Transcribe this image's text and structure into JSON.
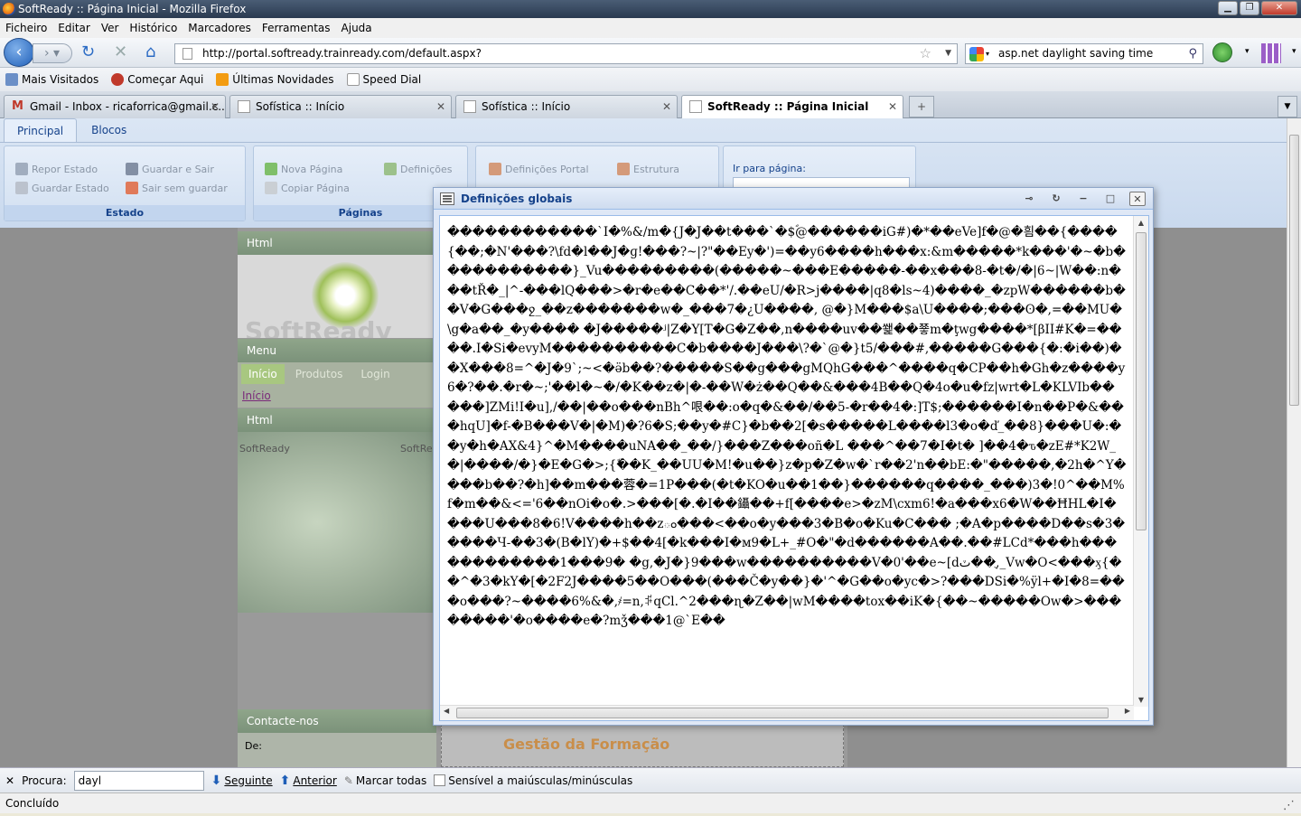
{
  "window": {
    "title": "SoftReady :: Página Inicial - Mozilla Firefox"
  },
  "menu": [
    "Ficheiro",
    "Editar",
    "Ver",
    "Histórico",
    "Marcadores",
    "Ferramentas",
    "Ajuda"
  ],
  "nav": {
    "url": "http://portal.softready.trainready.com/default.aspx?",
    "search_value": "asp.net daylight saving time"
  },
  "bookmarks": [
    "Mais Visitados",
    "Começar Aqui",
    "Últimas Novidades",
    "Speed Dial"
  ],
  "tabs": [
    {
      "label": "Gmail - Inbox - ricaforrica@gmail.c..."
    },
    {
      "label": "Sofística :: Início"
    },
    {
      "label": "Sofística :: Início"
    },
    {
      "label": "SoftReady :: Página Inicial"
    }
  ],
  "ribbon": {
    "tabs": [
      "Principal",
      "Blocos"
    ],
    "estado": {
      "repor": "Repor Estado",
      "guardar_sair": "Guardar e Sair",
      "guardar_estado": "Guardar Estado",
      "sair_sem": "Sair sem guardar",
      "label": "Estado"
    },
    "paginas": {
      "nova": "Nova Página",
      "definicoes": "Definições",
      "copiar": "Copiar Página",
      "label": "Páginas"
    },
    "portal": {
      "definicoes_portal": "Definições Portal",
      "estrutura": "Estrutura"
    },
    "ir_para": "Ir para página:"
  },
  "portal": {
    "html_header": "Html",
    "logo_text": "SoftReady",
    "menu_header": "Menu",
    "menu_links": [
      "Início",
      "Produtos",
      "Login"
    ],
    "inicio_link": "Início",
    "html_header2": "Html",
    "softready_small_1": "SoftReady",
    "softready_small_2": "SoftRe",
    "contact_header": "Contacte-nos",
    "de_label": "De:",
    "gestao_title": "Gestão da Formação"
  },
  "dialog": {
    "title": "Definições globais",
    "body_text": "������������`I�%&/m�{J�J��t���`�$ؐ@������iG#)�*��eVe]f�@�흼��{����{��;�N'���?\\fd�l��J�ɡ!���?~|?\"��Ey�')=��y6����h���x:&m�����*k���'�~�b�����������}_Vu���������(�����~���E�����-��x���8-�t�/�|6~|W��:n���tŘ�_|^-���lQ���>�r�e��C��*'/.��eU/�R>j����|q8�ls~4)����_�zpW������b��V�G���ջ_��z�������w�_���7�¿U����, @�}M���$a\\U����;���ʘ�,=��MU� \\g�a��_�y���� �J�����ʲ|Z�Y[T�G�Z��,n����uv��쐝��쭇m�ţwg����*[βII#K�=����.I�Si�evyM����������C�b����J���\\?�`@�}t5/���#,�����G���{�:�i��)��X���8=^�J�9`;~<�ӛb��?�����S��g���gMQhG���^����q�CP��h�Gh�z����y6�?��.�r�~;'��l�~�/�K��z�|�-��W�ż��Q��&���4B��Q�4o�u�fz|wrt�L�KLVIb�����]ZMi!I�u],/��|��o���nBh^哏��:o�q�&��/��5-�r��4�:]T$;������I�n��P�&���hqU]�f-�B���V�|�M)�?6�S;��y�#C}�b��2[�s�����L����l3�o�ď_��8}���U�:��y�h�AX&4}^�M����uNA��_��/}���Z���oñ�L ���^��7�I�t� ]��4�ԏ�zE#*K2W_�|����/�}�E�G�>;{�ّ�K_��UU�M!�u��}z�p�Z�w�`r��2'n��bE:�\"�����,�2h�^Y����b��?�h]��m���蓉�=1P���(�t�KO�u��1��}������q����_���)3�!0^��M%f�m��&<='6��nOi�o�.>���[�.�I��鑷��+f[����e>�zM\\cxm6!�a���x6�W��ĦHL�I����U���8�6!V����h��zం���<��o�y���3�B�o�Ku�C��� ;�A�p����D��s�3�����Ч-��3�(B�lY)�+$��4[�k���I�м9�L+_#O�\"�d������A��.��#LCd*���h������������1���9� �g,�J�}9���w����������V�0'��e~[dٽ��ֻ,_Vw�O<���ӽ{��^�3�kY�[�2F2J����5��O���(���Č�y��}�'^�G��o�yc�>?���DSi�%ÿl+�I�8=���ο���?~����6%&�,҂=n,ꌭqCl.^2���ɳ�Z��|wM����tox��iK�{��~�����Ow�>��������'�o����e�?mǯ���1@`E��"
  },
  "find": {
    "label": "Procura:",
    "value": "dayl",
    "next": "Seguinte",
    "prev": "Anterior",
    "highlight": "Marcar todas",
    "match_case": "Sensível a maiúsculas/minúsculas"
  },
  "status": {
    "text": "Concluído"
  }
}
